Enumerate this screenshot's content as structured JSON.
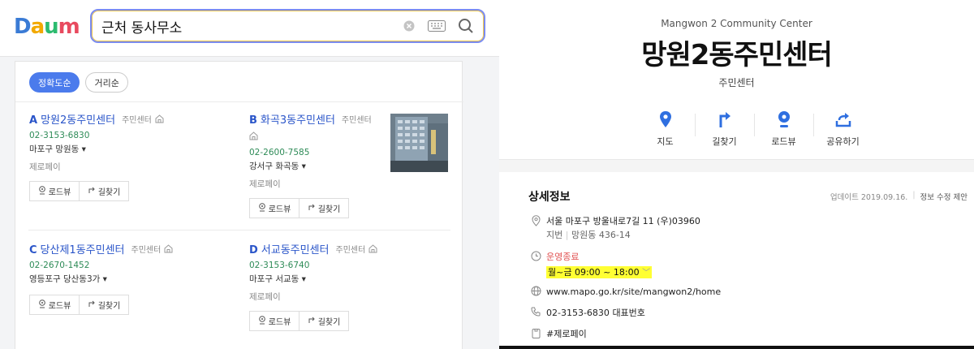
{
  "left": {
    "logo": {
      "letters": [
        "D",
        "a",
        "u",
        "m"
      ],
      "colors": [
        "#3a7bd5",
        "#f2a900",
        "#2dbb6f",
        "#e84a5f"
      ]
    },
    "search": {
      "value": "근처 동사무소"
    },
    "icons": {
      "clear": "clear-icon",
      "keyboard": "keyboard-icon",
      "search": "search-icon"
    },
    "sort": {
      "accuracy": "정확도순",
      "distance": "거리순"
    },
    "results": [
      {
        "letter": "A",
        "name": "망원2동주민센터",
        "category": "주민센터",
        "phone": "02-3153-6830",
        "address": "마포구 망원동 ▾",
        "pay": "제로페이",
        "roadview": "로드뷰",
        "directions": "길찾기"
      },
      {
        "letter": "B",
        "name": "화곡3동주민센터",
        "category": "주민센터",
        "phone": "02-2600-7585",
        "address": "강서구 화곡동 ▾",
        "pay": "제로페이",
        "roadview": "로드뷰",
        "directions": "길찾기"
      },
      {
        "letter": "C",
        "name": "당산제1동주민센터",
        "category": "주민센터",
        "phone": "02-2670-1452",
        "address": "영등포구 당산동3가 ▾",
        "pay": "",
        "roadview": "로드뷰",
        "directions": "길찾기"
      },
      {
        "letter": "D",
        "name": "서교동주민센터",
        "category": "주민센터",
        "phone": "02-3153-6740",
        "address": "마포구 서교동 ▾",
        "pay": "제로페이",
        "roadview": "로드뷰",
        "directions": "길찾기"
      }
    ]
  },
  "right": {
    "en_name": "Mangwon 2 Community Center",
    "ko_name": "망원2동주민센터",
    "category": "주민센터",
    "actions": [
      {
        "label": "지도",
        "icon": "map-pin-icon"
      },
      {
        "label": "길찾기",
        "icon": "directions-icon"
      },
      {
        "label": "로드뷰",
        "icon": "roadview-icon"
      },
      {
        "label": "공유하기",
        "icon": "share-icon"
      }
    ],
    "detail_title": "상세정보",
    "updated": "업데이트 2019.09.16.",
    "suggest_edit": "정보 수정 제안",
    "address": "서울 마포구 방울내로7길 11 (우)03960",
    "jibun_label": "지번",
    "jibun": "망원동 436-14",
    "status": "운영종료",
    "hours": "월~금  09:00 ~ 18:00",
    "website": "www.mapo.go.kr/site/mangwon2/home",
    "phone": "02-3153-6830",
    "phone_label": "대표번호",
    "tag": "#제로페이",
    "accent": "#2f6fe0",
    "highlight": "#ffff33"
  }
}
